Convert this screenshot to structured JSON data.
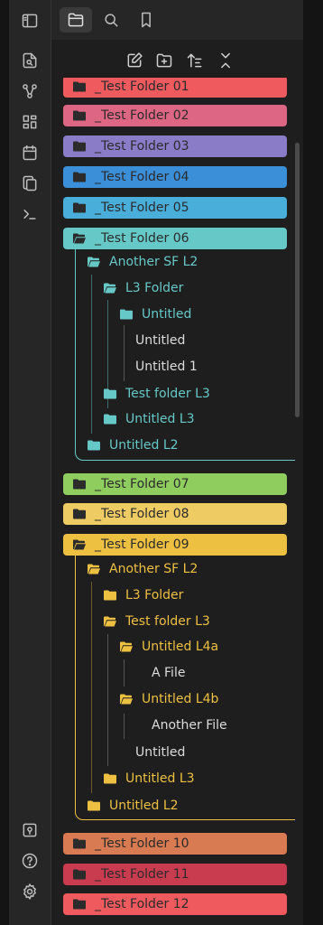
{
  "ribbon": {
    "icons": [
      "sidebar-toggle-icon",
      "search-file-icon",
      "graph-view-icon",
      "grid-icon",
      "calendar-icon",
      "copy-icon",
      "terminal-icon",
      "vault-icon",
      "help-icon",
      "settings-icon"
    ]
  },
  "tabs": {
    "icons": [
      "folder-icon",
      "search-icon",
      "bookmark-icon"
    ],
    "active": "folder-icon"
  },
  "toolbar": {
    "icons": [
      "new-note-icon",
      "new-folder-icon",
      "sort-icon",
      "collapse-icon"
    ]
  },
  "colors": {
    "text_dark": "#2b2b2b",
    "sub_text": "#dcdcdc",
    "folder06_accent": "#66c9c7",
    "folder09_accent": "#eec042"
  },
  "tree": {
    "folders": [
      {
        "label": "_Test Folder 01",
        "color": "#ef5a5e"
      },
      {
        "label": "_Test Folder 02",
        "color": "#dd6684"
      },
      {
        "label": "_Test Folder 03",
        "color": "#8b7cc8"
      },
      {
        "label": "_Test Folder 04",
        "color": "#3b8fd8"
      },
      {
        "label": "_Test Folder 05",
        "color": "#4aaeda"
      },
      {
        "label": "_Test Folder 06",
        "color": "#66c9c7"
      },
      {
        "label": "_Test Folder 07",
        "color": "#90cd5f"
      },
      {
        "label": "_Test Folder 08",
        "color": "#efcb64"
      },
      {
        "label": "_Test Folder 09",
        "color": "#eec042"
      },
      {
        "label": "_Test Folder 10",
        "color": "#d87a52"
      },
      {
        "label": "_Test Folder 11",
        "color": "#c93b4f"
      },
      {
        "label": "_Test Folder 12",
        "color": "#ef5a5e"
      }
    ],
    "f06": {
      "another_sf": "Another SF L2",
      "l3_folder": "L3 Folder",
      "untitled_folder": "Untitled",
      "untitled_note": "Untitled",
      "untitled_1": "Untitled 1",
      "test_folder_l3": "Test folder L3",
      "untitled_l3": "Untitled L3",
      "untitled_l2": "Untitled L2"
    },
    "f09": {
      "another_sf": "Another SF L2",
      "l3_folder": "L3 Folder",
      "test_folder_l3": "Test folder L3",
      "untitled_l4a": "Untitled L4a",
      "a_file": "A File",
      "untitled_l4b": "Untitled L4b",
      "another_file": "Another File",
      "untitled_note": "Untitled",
      "untitled_l3": "Untitled L3",
      "untitled_l2": "Untitled L2"
    }
  }
}
